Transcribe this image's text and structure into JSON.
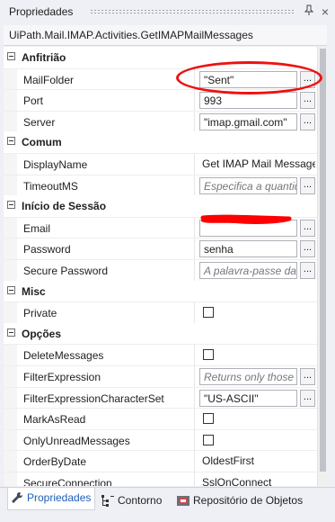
{
  "panel": {
    "title": "Propriedades"
  },
  "activity": {
    "name": "UiPath.Mail.IMAP.Activities.GetIMAPMailMessages"
  },
  "categories": [
    {
      "label": "Anfitrião",
      "properties": [
        {
          "name": "MailFolder",
          "value": "\"Sent\"",
          "kind": "text"
        },
        {
          "name": "Port",
          "value": "993",
          "kind": "text"
        },
        {
          "name": "Server",
          "value": "\"imap.gmail.com\"",
          "kind": "text"
        }
      ]
    },
    {
      "label": "Comum",
      "properties": [
        {
          "name": "DisplayName",
          "value": "Get IMAP Mail Message",
          "kind": "plain"
        },
        {
          "name": "TimeoutMS",
          "placeholder": "Especifica a quantidade",
          "kind": "placeholder"
        }
      ]
    },
    {
      "label": "Início de Sessão",
      "properties": [
        {
          "name": "Email",
          "value": "",
          "kind": "redacted"
        },
        {
          "name": "Password",
          "value": "senha",
          "kind": "text"
        },
        {
          "name": "Secure Password",
          "placeholder": "A palavra-passe da",
          "kind": "placeholder"
        }
      ]
    },
    {
      "label": "Misc",
      "properties": [
        {
          "name": "Private",
          "checked": false,
          "kind": "checkbox"
        }
      ]
    },
    {
      "label": "Opções",
      "properties": [
        {
          "name": "DeleteMessages",
          "checked": false,
          "kind": "checkbox"
        },
        {
          "name": "FilterExpression",
          "placeholder": "Returns only those",
          "kind": "placeholder"
        },
        {
          "name": "FilterExpressionCharacterSet",
          "value": "\"US-ASCII\"",
          "kind": "dropdown"
        },
        {
          "name": "MarkAsRead",
          "checked": false,
          "kind": "checkbox"
        },
        {
          "name": "OnlyUnreadMessages",
          "checked": false,
          "kind": "checkbox"
        },
        {
          "name": "OrderByDate",
          "value": "OldestFirst",
          "kind": "plain"
        },
        {
          "name": "SecureConnection",
          "value": "SslOnConnect",
          "kind": "plain"
        }
      ]
    }
  ],
  "tabs": [
    {
      "label": "Propriedades",
      "icon": "wrench-icon",
      "active": true
    },
    {
      "label": "Contorno",
      "icon": "outline-tree-icon",
      "active": false
    },
    {
      "label": "Repositório de Objetos",
      "icon": "object-repository-icon",
      "active": false
    }
  ],
  "annotations": {
    "highlight_color": "#ee1111",
    "redaction_color": "#ff0000"
  }
}
